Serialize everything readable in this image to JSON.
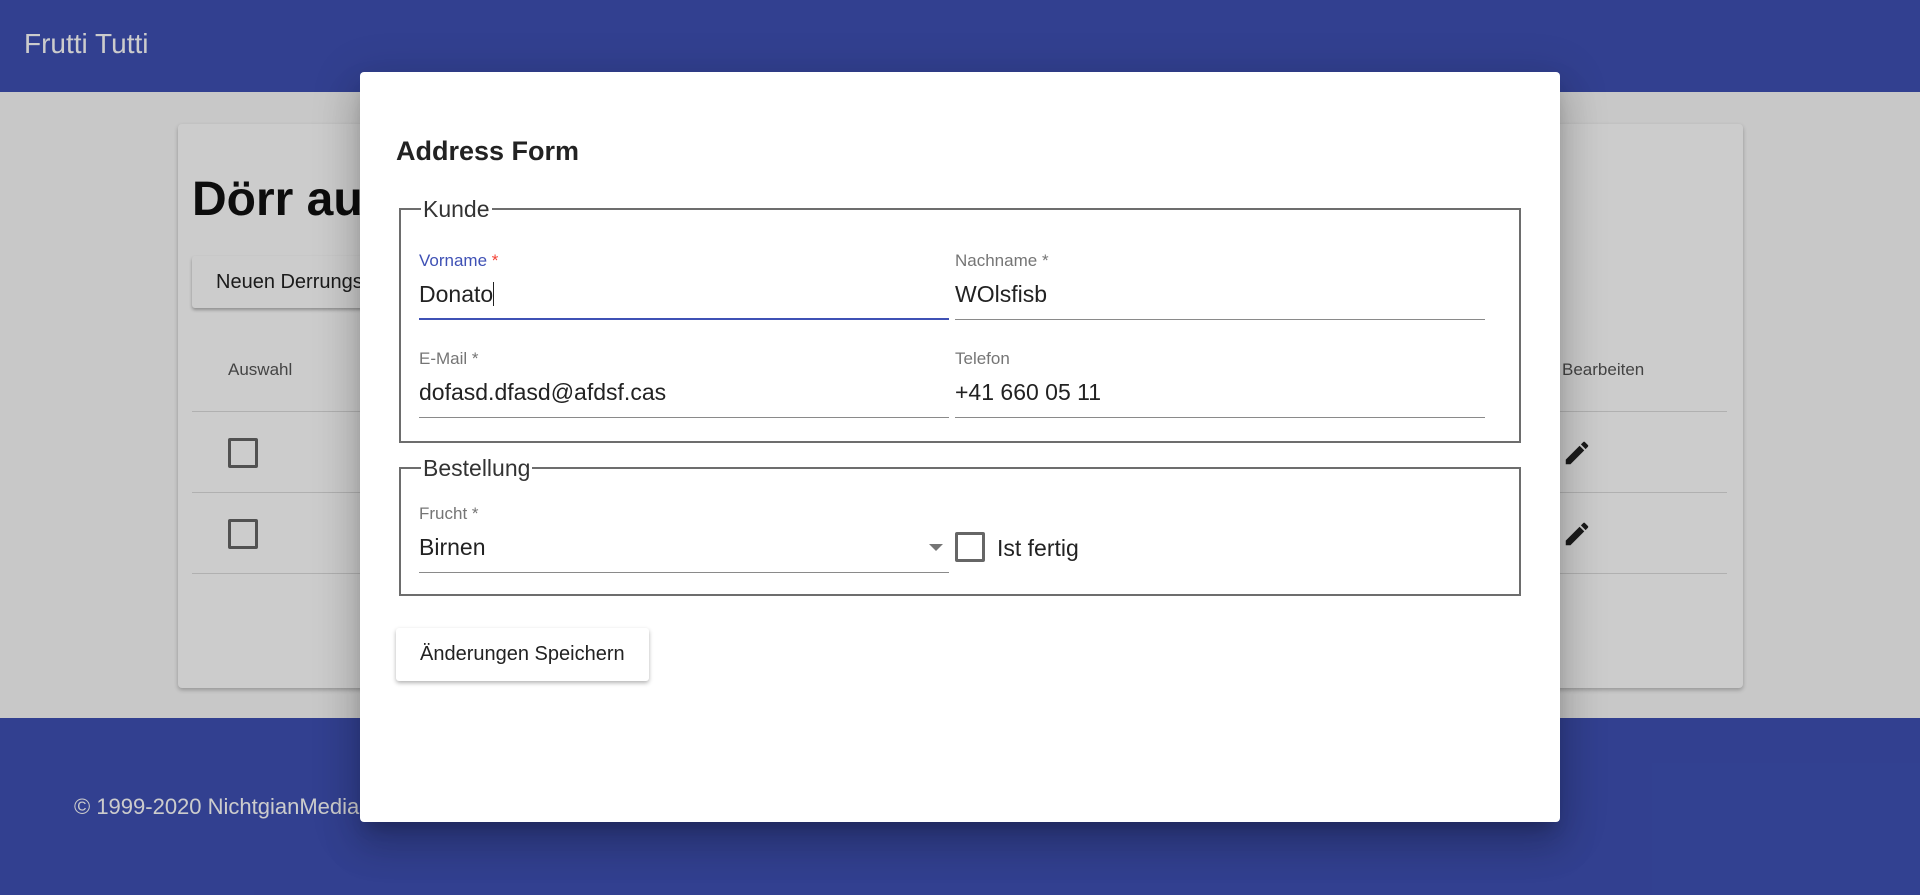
{
  "app": {
    "title": "Frutti Tutti",
    "footer": "© 1999-2020 NichtgianMedia"
  },
  "background_card": {
    "title": "Dörr aufträge",
    "new_button": "Neuen Derrungsauftrag erstellen",
    "table_headers": {
      "select": "Auswahl",
      "edit": "Bearbeiten"
    },
    "rows": 2
  },
  "dialog": {
    "title": "Address Form",
    "fieldset_customer": {
      "legend": "Kunde",
      "first_name": {
        "label": "Vorname",
        "required_mark": "*",
        "value": "Donato"
      },
      "last_name": {
        "label": "Nachname",
        "required_mark": "*",
        "value": "WOlsfisb"
      },
      "email": {
        "label": "E-Mail",
        "required_mark": "*",
        "value": "dofasd.dfasd@afdsf.cas"
      },
      "phone": {
        "label": "Telefon",
        "value": "+41 660 05 11"
      }
    },
    "fieldset_order": {
      "legend": "Bestellung",
      "fruit": {
        "label": "Frucht",
        "required_mark": "*",
        "value": "Birnen"
      },
      "done": {
        "label": "Ist fertig",
        "checked": false
      }
    },
    "save_button": "Änderungen Speichern"
  },
  "colors": {
    "primary": "#3f51b5",
    "required": "#f44336",
    "backdrop": "rgba(0,0,0,0.2)"
  }
}
